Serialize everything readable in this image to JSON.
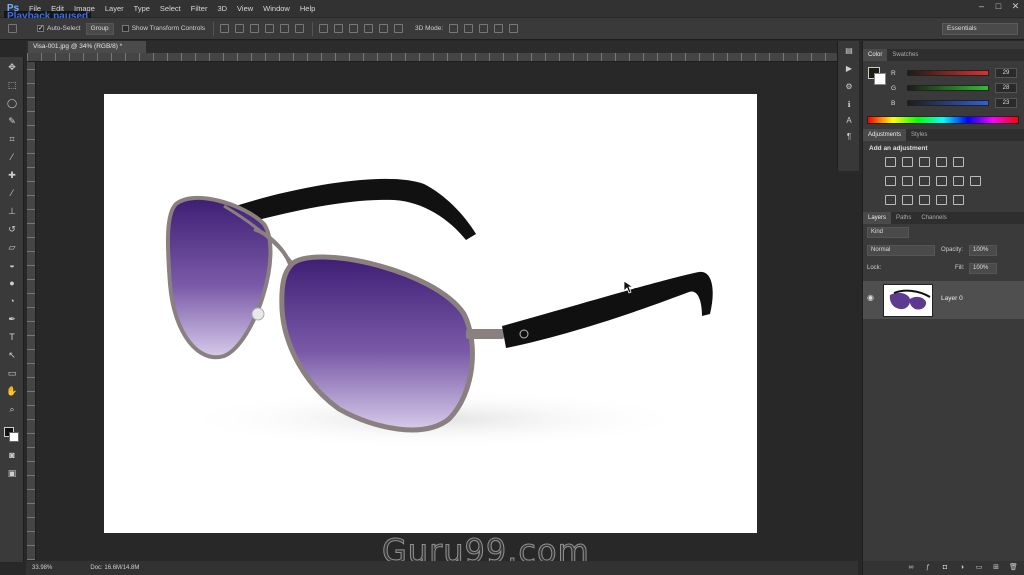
{
  "overlay": {
    "playback": "Playback paused"
  },
  "menubar": {
    "logo": "Ps",
    "items": [
      "File",
      "Edit",
      "Image",
      "Layer",
      "Type",
      "Select",
      "Filter",
      "3D",
      "View",
      "Window",
      "Help"
    ]
  },
  "options": {
    "auto_select_label": "Auto-Select",
    "auto_select_value": "Group",
    "transform_label": "Show Transform Controls",
    "mode_label": "3D Mode:",
    "workspace": "Essentials"
  },
  "document": {
    "tab_title": "Visa-001.jpg @ 34% (RGB/8) *",
    "zoom": "33.98%",
    "doc_size": "Doc: 16.6M/14.8M"
  },
  "watermark": "Guru99.com",
  "color_panel": {
    "tabs": [
      "Color",
      "Swatches"
    ],
    "channels": [
      {
        "label": "R",
        "value": "29",
        "track_color": "#e03030"
      },
      {
        "label": "G",
        "value": "28",
        "track_color": "#30c030"
      },
      {
        "label": "B",
        "value": "23",
        "track_color": "#3060e0"
      }
    ]
  },
  "adjustments_panel": {
    "tabs": [
      "Adjustments",
      "Styles"
    ],
    "heading": "Add an adjustment"
  },
  "layers_panel": {
    "tabs": [
      "Layers",
      "Paths",
      "Channels"
    ],
    "kind_label": "Kind",
    "blend_mode": "Normal",
    "opacity_label": "Opacity:",
    "opacity_value": "100%",
    "lock_label": "Lock:",
    "fill_label": "Fill:",
    "fill_value": "100%",
    "layer_name": "Layer 0"
  },
  "colors": {
    "lens_top": "#3d1e73",
    "lens_bottom": "#c9b8e6",
    "frame": "#8a8080",
    "temple": "#101010"
  }
}
